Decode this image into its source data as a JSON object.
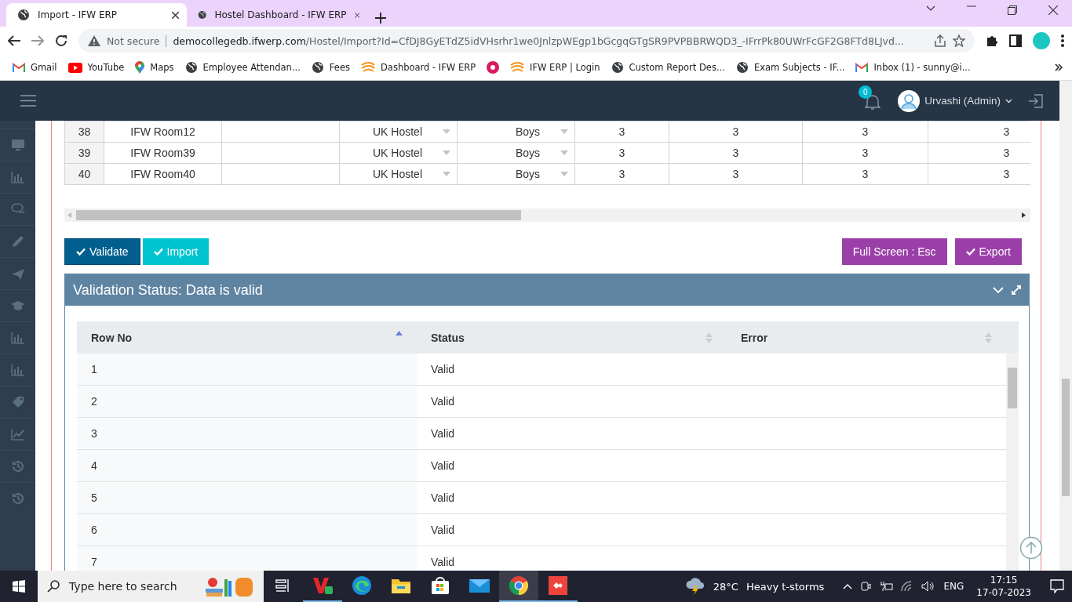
{
  "browser": {
    "tabs": [
      {
        "title": "Import - IFW ERP",
        "selected": true
      },
      {
        "title": "Hostel Dashboard - IFW ERP",
        "selected": false
      }
    ],
    "security": "Not secure",
    "url_host": "democollegedb.ifwerp.com",
    "url_path": "/Hostel/Import?Id=CfDJ8GyETdZ5idVHsrhr1we0JnlzpWEgp1bGcgqGTgSR9PVPBBRWQD3_-IFrrPk80UWrFcGF2G8FTd8LJvd...",
    "bookmarks": [
      {
        "label": "Gmail"
      },
      {
        "label": "YouTube"
      },
      {
        "label": "Maps"
      },
      {
        "label": "Employee Attendan..."
      },
      {
        "label": "Fees"
      },
      {
        "label": "Dashboard - IFW ERP"
      },
      {
        "label": "IFW ERP | Login"
      },
      {
        "label": "Custom Report Des..."
      },
      {
        "label": "Exam Subjects - IF..."
      },
      {
        "label": "Inbox (1) - sunny@i..."
      }
    ]
  },
  "header": {
    "notification_count": "0",
    "user": "Urvashi (Admin)"
  },
  "grid": {
    "rows": [
      {
        "row_no": "38",
        "room": "IFW Room12",
        "hostel": "UK Hostel",
        "gender": "Boys",
        "values": [
          "3",
          "3",
          "3",
          "3"
        ]
      },
      {
        "row_no": "39",
        "room": "IFW Room39",
        "hostel": "UK Hostel",
        "gender": "Boys",
        "values": [
          "3",
          "3",
          "3",
          "3"
        ]
      },
      {
        "row_no": "40",
        "room": "IFW Room40",
        "hostel": "UK Hostel",
        "gender": "Boys",
        "values": [
          "3",
          "3",
          "3",
          "3"
        ]
      }
    ]
  },
  "buttons": {
    "left": [
      {
        "label": "Validate",
        "check": true
      },
      {
        "label": "Import",
        "check": true
      }
    ],
    "right": [
      {
        "label": "Full Screen : Esc",
        "check": false
      },
      {
        "label": "Export",
        "check": true
      }
    ]
  },
  "validation": {
    "title": "Validation Status: Data is valid",
    "columns": [
      {
        "label": "Row No",
        "sorted": true
      },
      {
        "label": "Status",
        "sorted": false
      },
      {
        "label": "Error",
        "sorted": false
      }
    ],
    "rows": [
      {
        "row_no": "1",
        "status": "Valid"
      },
      {
        "row_no": "2",
        "status": "Valid"
      },
      {
        "row_no": "3",
        "status": "Valid"
      },
      {
        "row_no": "4",
        "status": "Valid"
      },
      {
        "row_no": "5",
        "status": "Valid"
      },
      {
        "row_no": "6",
        "status": "Valid"
      },
      {
        "row_no": "7",
        "status": "Valid"
      }
    ]
  },
  "taskbar": {
    "search_placeholder": "Type here to search",
    "apps": [
      {
        "running": false,
        "selected": false
      },
      {
        "running": true,
        "selected": false
      },
      {
        "running": false,
        "selected": false
      },
      {
        "running": false,
        "selected": false
      },
      {
        "running": false,
        "selected": false
      },
      {
        "running": false,
        "selected": false
      },
      {
        "running": true,
        "selected": true
      },
      {
        "running": true,
        "selected": false
      }
    ],
    "temperature": "28°C",
    "weather": "Heavy t-storms",
    "language": "ENG",
    "time": "17:15",
    "date": "17-07-2023"
  }
}
